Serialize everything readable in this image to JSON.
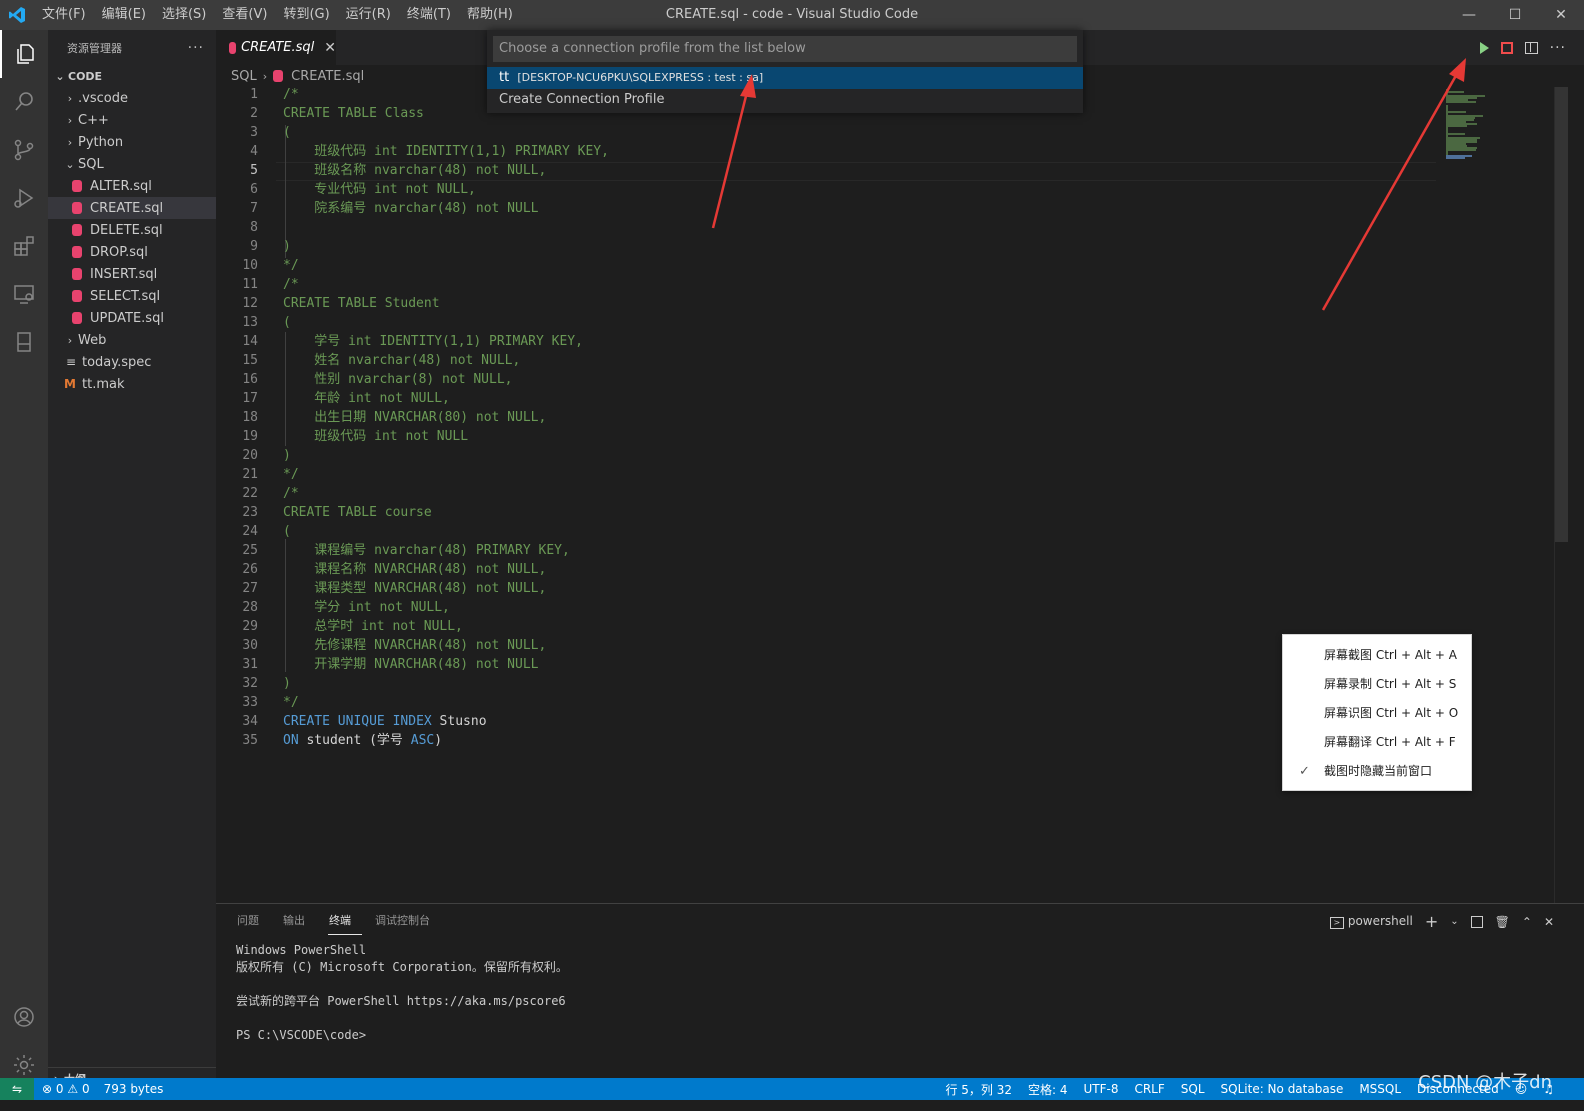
{
  "window": {
    "title": "CREATE.sql - code - Visual Studio Code",
    "menu": [
      "文件(F)",
      "编辑(E)",
      "选择(S)",
      "查看(V)",
      "转到(G)",
      "运行(R)",
      "终端(T)",
      "帮助(H)"
    ]
  },
  "sidebar": {
    "header": "资源管理器",
    "section": "CODE",
    "folders": [
      ".vscode",
      "C++",
      "Python"
    ],
    "sql_folder": "SQL",
    "sql_files": [
      "ALTER.sql",
      "CREATE.sql",
      "DELETE.sql",
      "DROP.sql",
      "INSERT.sql",
      "SELECT.sql",
      "UPDATE.sql"
    ],
    "web_folder": "Web",
    "files": [
      "today.spec",
      "tt.mak"
    ],
    "outline": "大纲"
  },
  "tab": {
    "label": "CREATE.sql",
    "close": "✕"
  },
  "breadcrumb": {
    "folder": "SQL",
    "file": "CREATE.sql"
  },
  "quickpick": {
    "placeholder": "Choose a connection profile from the list below",
    "item1_label": "tt",
    "item1_desc": "[DESKTOP-NCU6PKU\\SQLEXPRESS : test : sa]",
    "item2_label": "Create Connection Profile"
  },
  "code": {
    "current_line": 5,
    "lines": [
      "/*",
      "CREATE TABLE Class",
      "(",
      "    班级代码 int IDENTITY(1,1) PRIMARY KEY,",
      "    班级名称 nvarchar(48) not NULL,",
      "    专业代码 int not NULL,",
      "    院系编号 nvarchar(48) not NULL",
      "",
      ")",
      "*/",
      "/*",
      "CREATE TABLE Student",
      "(",
      "    学号 int IDENTITY(1,1) PRIMARY KEY,",
      "    姓名 nvarchar(48) not NULL,",
      "    性别 nvarchar(8) not NULL,",
      "    年龄 int not NULL,",
      "    出生日期 NVARCHAR(80) not NULL,",
      "    班级代码 int not NULL",
      ")",
      "*/",
      "/*",
      "CREATE TABLE course",
      "(",
      "    课程编号 nvarchar(48) PRIMARY KEY,",
      "    课程名称 NVARCHAR(48) not NULL,",
      "    课程类型 NVARCHAR(48) not NULL,",
      "    学分 int not NULL,",
      "    总学时 int not NULL,",
      "    先修课程 NVARCHAR(48) not NULL,",
      "    开课学期 NVARCHAR(48) not NULL",
      ")",
      "*/",
      "CREATE UNIQUE INDEX Stusno",
      "ON student (学号 ASC)"
    ]
  },
  "panel": {
    "tabs": [
      "问题",
      "输出",
      "终端",
      "调试控制台"
    ],
    "active_tab": "终端",
    "shell": "powershell",
    "terminal_lines": [
      "Windows PowerShell",
      "版权所有 (C) Microsoft Corporation。保留所有权利。",
      "",
      "尝试新的跨平台 PowerShell https://aka.ms/pscore6",
      "",
      "PS C:\\VSCODE\\code>"
    ]
  },
  "context_menu": {
    "items": [
      "屏幕截图 Ctrl + Alt + A",
      "屏幕录制 Ctrl + Alt + S",
      "屏幕识图 Ctrl + Alt + O",
      "屏幕翻译 Ctrl + Alt + F",
      "截图时隐藏当前窗口"
    ],
    "checked_index": 4
  },
  "statusbar": {
    "errors": "0",
    "warnings": "0",
    "size": "793 bytes",
    "position": "行 5，列 32",
    "spaces": "空格: 4",
    "encoding": "UTF-8",
    "eol": "CRLF",
    "language": "SQL",
    "sqlite": "SQLite: No database",
    "mssql": "MSSQL",
    "connection": "Disconnected"
  },
  "watermark": "CSDN @木子dn",
  "colors": {
    "accent": "#007acc",
    "comment": "#6a9955",
    "keyword": "#569cd6",
    "annotation_arrow": "#e53935"
  }
}
